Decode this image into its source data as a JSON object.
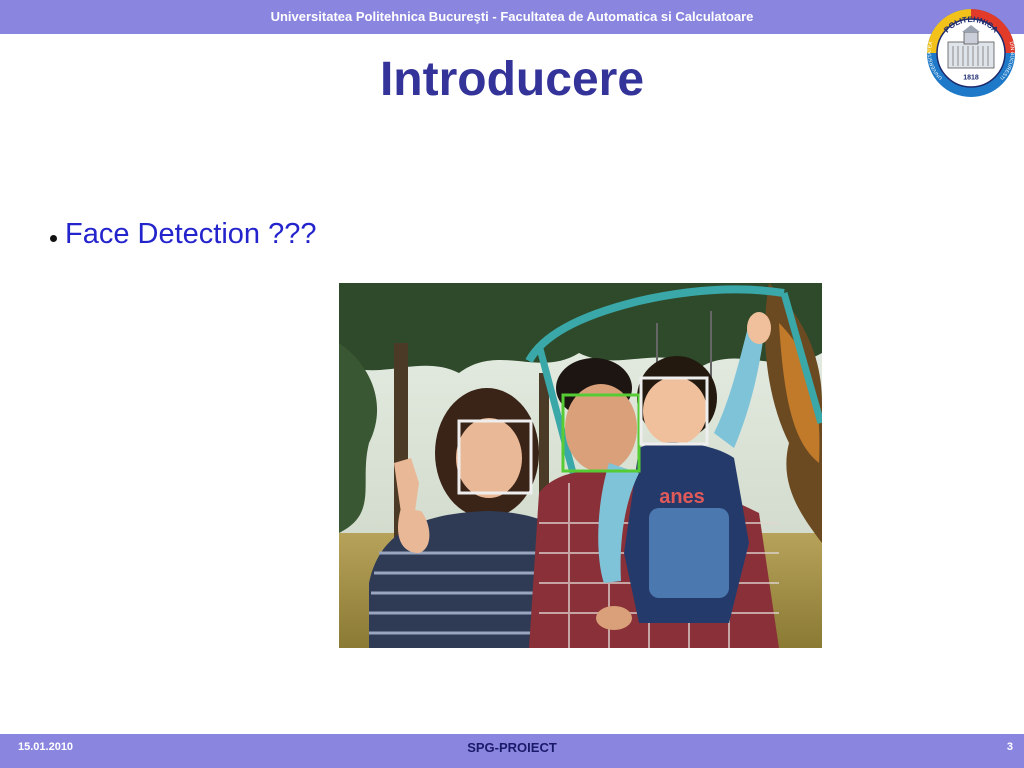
{
  "header": {
    "institution": "Universitatea Politehnica Bucureşti - Facultatea de Automatica si Calculatoare"
  },
  "logo": {
    "top_text": "POLITEHNICA",
    "left_text": "UNIVERSITATEA",
    "right_text": "DIN BUCURESTI",
    "year": "1818",
    "icon": "university-seal-icon"
  },
  "slide": {
    "title": "Introducere",
    "bullets": [
      "Face Detection ???"
    ]
  },
  "image": {
    "icon": "family-photo-with-face-detection-boxes",
    "shirt_text": "anes"
  },
  "footer": {
    "date": "15.01.2010",
    "center": "SPG-PROIECT",
    "page": "3"
  },
  "colors": {
    "band": "#8a86e0",
    "title": "#33339a",
    "bullet_text": "#2424cc",
    "box_white": "#eeeeee",
    "box_green": "#55cc33"
  }
}
